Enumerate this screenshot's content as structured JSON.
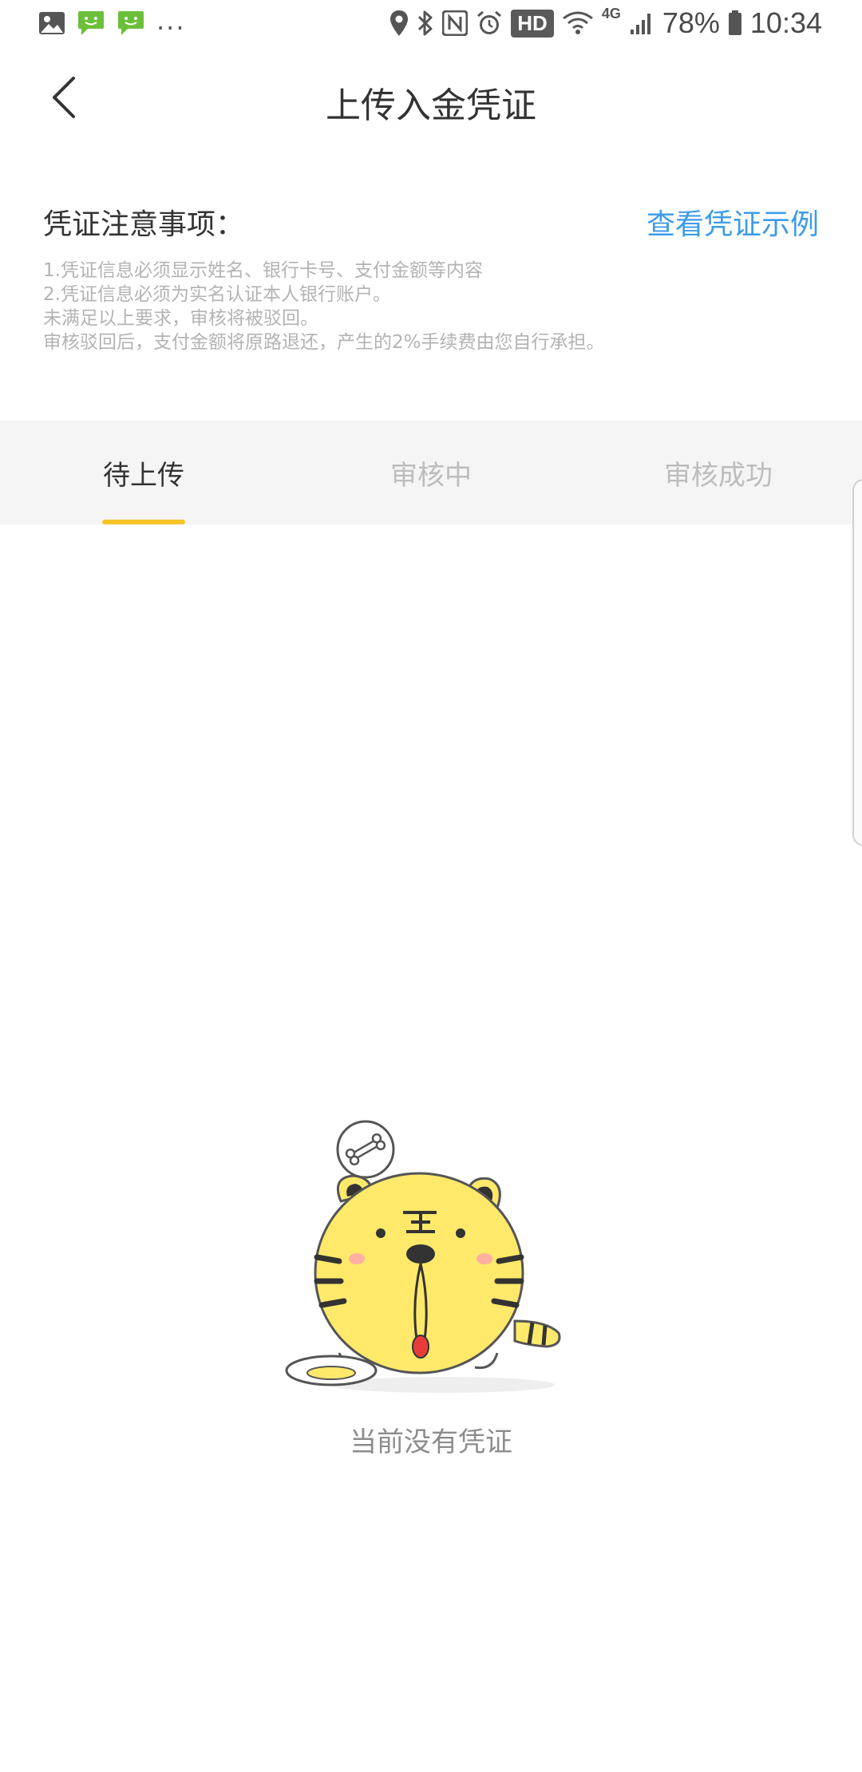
{
  "status_bar": {
    "left_icons": [
      "image-icon",
      "message-icon",
      "message-icon"
    ],
    "overflow": "...",
    "hd": "HD",
    "network": "4G",
    "battery": "78%",
    "time": "10:34"
  },
  "header": {
    "title": "上传入金凭证"
  },
  "notice": {
    "title": "凭证注意事项：",
    "example_link": "查看凭证示例",
    "lines": [
      "1.凭证信息必须显示姓名、银行卡号、支付金额等内容",
      "2.凭证信息必须为实名认证本人银行账户。",
      "未满足以上要求，审核将被驳回。",
      "审核驳回后，支付金额将原路退还，产生的2%手续费由您自行承担。"
    ]
  },
  "tabs": [
    {
      "label": "待上传",
      "active": true
    },
    {
      "label": "审核中",
      "active": false
    },
    {
      "label": "审核成功",
      "active": false
    }
  ],
  "colors": {
    "accent_yellow": "#f7c52b",
    "link_blue": "#3d9be9",
    "tiger_yellow": "#ffe96b"
  },
  "empty_state": {
    "message": "当前没有凭证"
  }
}
